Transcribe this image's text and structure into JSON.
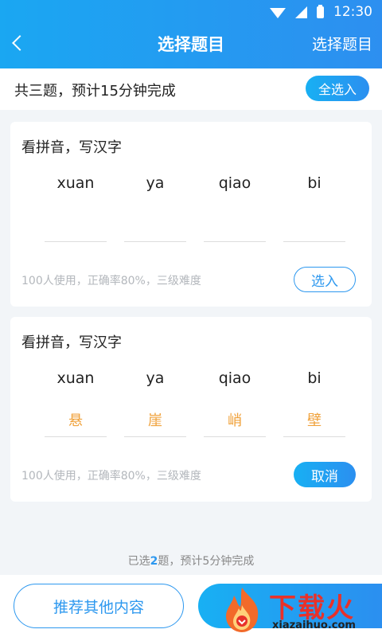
{
  "status_bar": {
    "time": "12:30"
  },
  "header": {
    "title": "选择题目",
    "action_label": "选择题目"
  },
  "summary": {
    "text": "共三题，预计15分钟完成",
    "select_all_label": "全选入"
  },
  "cards": [
    {
      "title": "看拼音，写汉字",
      "items": [
        {
          "pinyin": "xuan",
          "answer": ""
        },
        {
          "pinyin": "ya",
          "answer": ""
        },
        {
          "pinyin": "qiao",
          "answer": ""
        },
        {
          "pinyin": "bi",
          "answer": ""
        }
      ],
      "meta": "100人使用，正确率80%，三级难度",
      "button_label": "选入"
    },
    {
      "title": "看拼音，写汉字",
      "items": [
        {
          "pinyin": "xuan",
          "answer": "悬"
        },
        {
          "pinyin": "ya",
          "answer": "崖"
        },
        {
          "pinyin": "qiao",
          "answer": "峭"
        },
        {
          "pinyin": "bi",
          "answer": "壁"
        }
      ],
      "meta": "100人使用，正确率80%，三级难度",
      "button_label": "取消"
    }
  ],
  "footer": {
    "prefix": "已选",
    "count": "2",
    "suffix": "题，预计5分钟完成"
  },
  "bottom": {
    "recommend_label": "推荐其他内容"
  },
  "watermark": {
    "brand": "下载火",
    "url": "xiazaihuo.com"
  },
  "colors": {
    "accent": "#2d98ef",
    "answer": "#f0a23c",
    "brand_red": "#e8312a"
  }
}
